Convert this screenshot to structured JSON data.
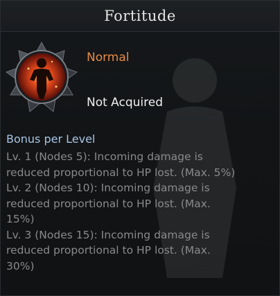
{
  "skill": {
    "title": "Fortitude",
    "grade": "Normal",
    "status": "Not Acquired",
    "icon": "flaming-figure-icon"
  },
  "bonus": {
    "heading": "Bonus per Level",
    "lines": [
      "Lv. 1 (Nodes 5): Incoming damage is",
      "reduced proportional to HP lost. (Max. 5%)",
      "Lv. 2 (Nodes 10): Incoming damage is",
      "reduced proportional to HP lost. (Max.",
      "15%)",
      "Lv. 3 (Nodes 15): Incoming damage is",
      "reduced proportional to HP lost. (Max.",
      "30%)"
    ]
  },
  "colors": {
    "grade": "#e88b45",
    "heading": "#a9c4e4",
    "body": "#8a8a8a",
    "title": "#e6e6e6"
  }
}
